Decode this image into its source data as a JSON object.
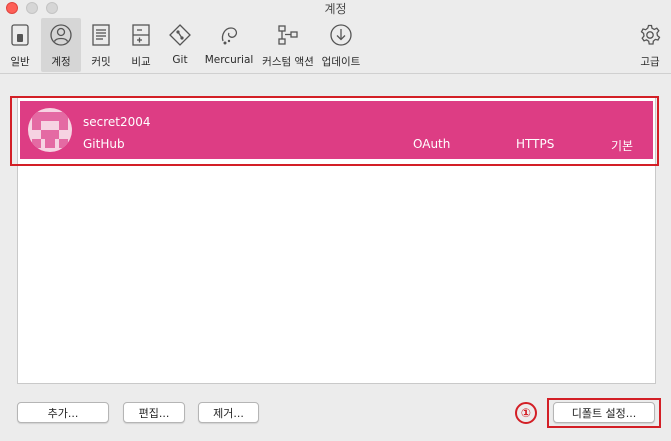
{
  "window": {
    "title": "계정"
  },
  "toolbar": {
    "tabs": [
      {
        "label": "일반",
        "icon": "switch-icon"
      },
      {
        "label": "계정",
        "icon": "account-icon",
        "selected": true
      },
      {
        "label": "커밋",
        "icon": "commit-document-icon"
      },
      {
        "label": "비교",
        "icon": "diff-icon"
      },
      {
        "label": "Git",
        "icon": "git-icon"
      },
      {
        "label": "Mercurial",
        "icon": "mercurial-icon"
      },
      {
        "label": "커스텀 액션",
        "icon": "custom-action-icon"
      },
      {
        "label": "업데이트",
        "icon": "update-icon"
      }
    ],
    "advanced": {
      "label": "고급",
      "icon": "gear-icon"
    }
  },
  "account": {
    "username": "secret2004",
    "host": "GitHub",
    "auth": "OAuth",
    "protocol": "HTTPS",
    "default": "기본"
  },
  "buttons": {
    "add": "추가...",
    "edit": "편집...",
    "remove": "제거...",
    "set_default": "디폴트 설정..."
  },
  "annotation": {
    "marker": "①"
  },
  "colors": {
    "selected_row": "#dd3d84",
    "highlight_border": "#d31f26",
    "avatar_light": "#f6d3e2",
    "avatar_dark": "#e46aa3"
  }
}
